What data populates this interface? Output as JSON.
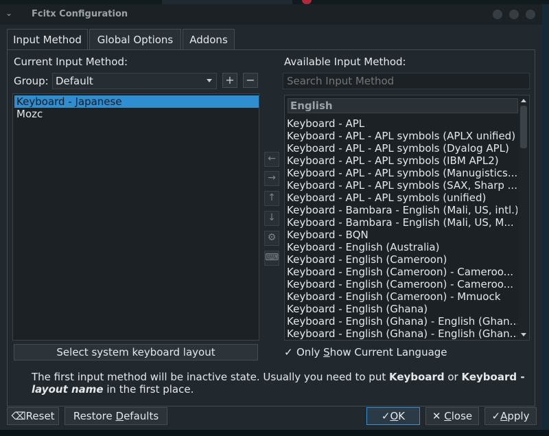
{
  "window": {
    "title": "Fcitx Configuration"
  },
  "tabs": [
    {
      "label": "Input Method"
    },
    {
      "label": "Global Options"
    },
    {
      "label": "Addons"
    }
  ],
  "current": {
    "heading": "Current Input Method:",
    "group_label": "Group:",
    "group_value": "Default",
    "items": [
      "Keyboard - Japanese",
      "Mozc"
    ],
    "select_layout_button": "Select system keyboard layout"
  },
  "available": {
    "heading": "Available Input Method:",
    "search_placeholder": "Search Input Method",
    "group": "English",
    "items": [
      "Keyboard - APL",
      "Keyboard - APL - APL symbols (APLX unified)",
      "Keyboard - APL - APL symbols (Dyalog APL)",
      "Keyboard - APL - APL symbols (IBM APL2)",
      "Keyboard - APL - APL symbols (Manugistics...",
      "Keyboard - APL - APL symbols (SAX, Sharp ...",
      "Keyboard - APL - APL symbols (unified)",
      "Keyboard - Bambara - English (Mali, US, intl.)",
      "Keyboard - Bambara - English (Mali, US, M...",
      "Keyboard - BQN",
      "Keyboard - English (Australia)",
      "Keyboard - English (Cameroon)",
      "Keyboard - English (Cameroon) - Cameroo...",
      "Keyboard - English (Cameroon) - Cameroo...",
      "Keyboard - English (Cameroon) - Mmuock",
      "Keyboard - English (Ghana)",
      "Keyboard - English (Ghana) - English (Ghan...",
      "Keyboard - English (Ghana) - English (Ghan..."
    ],
    "only_current_pre": "Only ",
    "only_current_key": "S",
    "only_current_post": "how Current Language",
    "only_current_checked": true
  },
  "info": {
    "text1": "The first input method will be inactive state. Usually you need to put ",
    "bold1": "Keyboard",
    "text2": " or ",
    "bold2": "Keyboard - ",
    "bold3": "layout name",
    "text3": " in the first place."
  },
  "buttons": {
    "reset": "Reset",
    "restore_pre": "Restore ",
    "restore_key": "D",
    "restore_post": "efaults",
    "ok_key": "O",
    "ok_post": "K",
    "close_key": "C",
    "close_post": "lose",
    "apply_key": "A",
    "apply_post": "pply"
  },
  "icons": {
    "add": "plus-icon",
    "remove": "minus-icon",
    "move_left": "arrow-left-icon",
    "move_right": "arrow-right-icon",
    "move_up": "arrow-up-icon",
    "move_down": "arrow-down-icon",
    "configure": "gear-icon",
    "keyboard": "keyboard-icon"
  }
}
